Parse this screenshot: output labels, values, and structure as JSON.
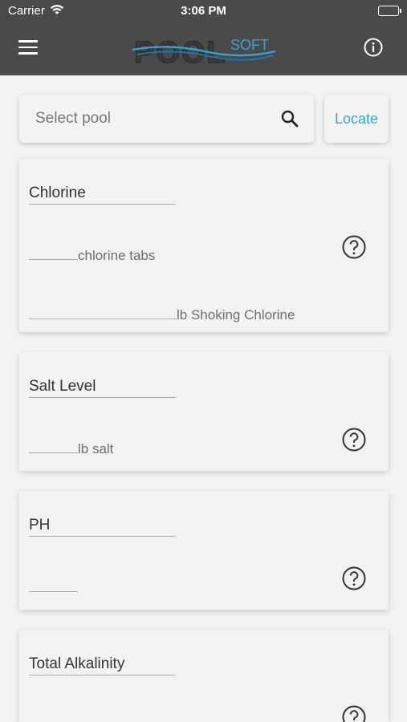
{
  "status_bar": {
    "carrier": "Carrier",
    "time": "3:06 PM"
  },
  "nav": {
    "logo_text_main": "POOL",
    "logo_text_accent": "SOFT",
    "menu_icon": "hamburger-icon",
    "info_icon": "info-icon"
  },
  "search": {
    "placeholder": "Select pool",
    "icon": "search-icon",
    "locate_label": "Locate"
  },
  "cards": {
    "chlorine": {
      "title": "Chlorine",
      "field_1_suffix": "chlorine tabs",
      "field_2_suffix": "lb Shoking Chlorine"
    },
    "salt": {
      "title": "Salt Level",
      "field_1_suffix": "lb salt"
    },
    "ph": {
      "title": "PH"
    },
    "alkalinity": {
      "title": "Total Alkalinity"
    }
  },
  "colors": {
    "nav_bg": "#4a4a4a",
    "accent": "#2fa6d9",
    "page_bg": "#f2f2f2"
  }
}
